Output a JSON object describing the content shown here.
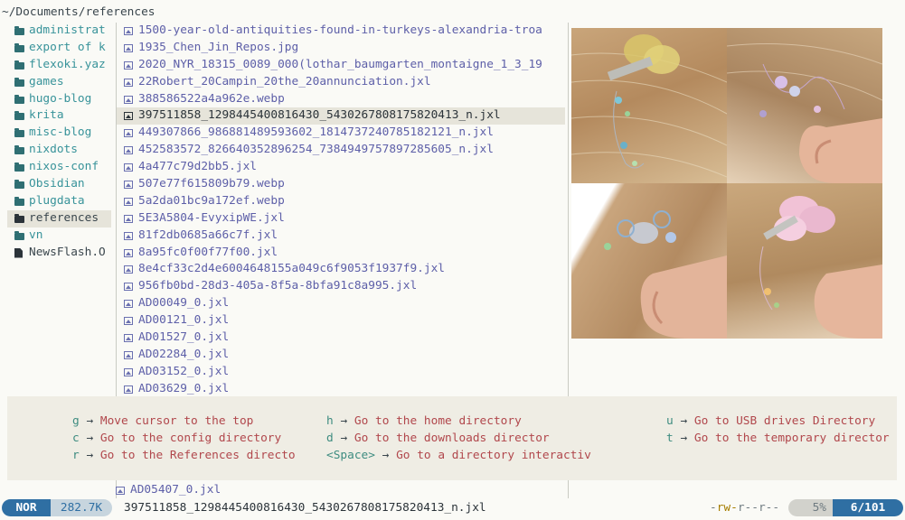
{
  "path": "~/Documents/references",
  "parent_dirs": [
    {
      "name": "administrat",
      "type": "dir"
    },
    {
      "name": "export of k",
      "type": "dir"
    },
    {
      "name": "flexoki.yaz",
      "type": "dir"
    },
    {
      "name": "games",
      "type": "dir"
    },
    {
      "name": "hugo-blog",
      "type": "dir"
    },
    {
      "name": "krita",
      "type": "dir"
    },
    {
      "name": "misc-blog",
      "type": "dir"
    },
    {
      "name": "nixdots",
      "type": "dir"
    },
    {
      "name": "nixos-conf",
      "type": "dir"
    },
    {
      "name": "Obsidian",
      "type": "dir"
    },
    {
      "name": "plugdata",
      "type": "dir"
    },
    {
      "name": "references",
      "type": "dir",
      "selected": true
    },
    {
      "name": "vn",
      "type": "dir"
    },
    {
      "name": "NewsFlash.O",
      "type": "file"
    }
  ],
  "files": [
    {
      "name": "1500-year-old-antiquities-found-in-turkeys-alexandria-troa"
    },
    {
      "name": "1935_Chen_Jin_Repos.jpg"
    },
    {
      "name": "2020_NYR_18315_0089_000(lothar_baumgarten_montaigne_1_3_19"
    },
    {
      "name": "22Robert_20Campin_20the_20annunciation.jxl"
    },
    {
      "name": "388586522a4a962e.webp"
    },
    {
      "name": "397511858_1298445400816430_5430267808175820413_n.jxl",
      "selected": true
    },
    {
      "name": "449307866_986881489593602_1814737240785182121_n.jxl"
    },
    {
      "name": "452583572_826640352896254_7384949757897285605_n.jxl"
    },
    {
      "name": "4a477c79d2bb5.jxl"
    },
    {
      "name": "507e77f615809b79.webp"
    },
    {
      "name": "5a2da01bc9a172ef.webp"
    },
    {
      "name": "5E3A5804-EvyxipWE.jxl"
    },
    {
      "name": "81f2db0685a66c7f.jxl"
    },
    {
      "name": "8a95fc0f00f77f00.jxl"
    },
    {
      "name": "8e4cf33c2d4e6004648155a049c6f9053f1937f9.jxl"
    },
    {
      "name": "956fb0bd-28d3-405a-8f5a-8bfa91c8a995.jxl"
    },
    {
      "name": "AD00049_0.jxl"
    },
    {
      "name": "AD00121_0.jxl"
    },
    {
      "name": "AD01527_0.jxl"
    },
    {
      "name": "AD02284_0.jxl"
    },
    {
      "name": "AD03152_0.jxl"
    },
    {
      "name": "AD03629_0.jxl"
    }
  ],
  "last_visible_file": "AD05407_0.jxl",
  "hints": [
    {
      "key": "g",
      "desc": "Move cursor to the top"
    },
    {
      "key": "h",
      "desc": "Go to the home directory"
    },
    {
      "key": "u",
      "desc": "Go to USB drives Directory"
    },
    {
      "key": "c",
      "desc": "Go to the config directory"
    },
    {
      "key": "d",
      "desc": "Go to the downloads director"
    },
    {
      "key": "t",
      "desc": "Go to the temporary director"
    },
    {
      "key": "r",
      "desc": "Go to the References directo"
    },
    {
      "key": "<Space>",
      "desc": "Go to a directory interactiv"
    }
  ],
  "hint_arrow": "→",
  "status": {
    "mode": "NOR",
    "size": "282.7K",
    "current_file": "397511858_1298445400816430_5430267808175820413_n.jxl",
    "perms": {
      "p1": "-",
      "p2": "rw-",
      "p3": "r--",
      "p4": "r--"
    },
    "percent": "5%",
    "position": "6/101"
  },
  "colors": {
    "accent": "#2f6fa3",
    "dir": "#38939a",
    "file": "#5d5fa8",
    "hint_key": "#3e8c80",
    "hint_desc": "#b1474c"
  },
  "preview_icons": {
    "image": "image-file-icon",
    "folder": "folder-icon",
    "doc": "document-icon"
  }
}
